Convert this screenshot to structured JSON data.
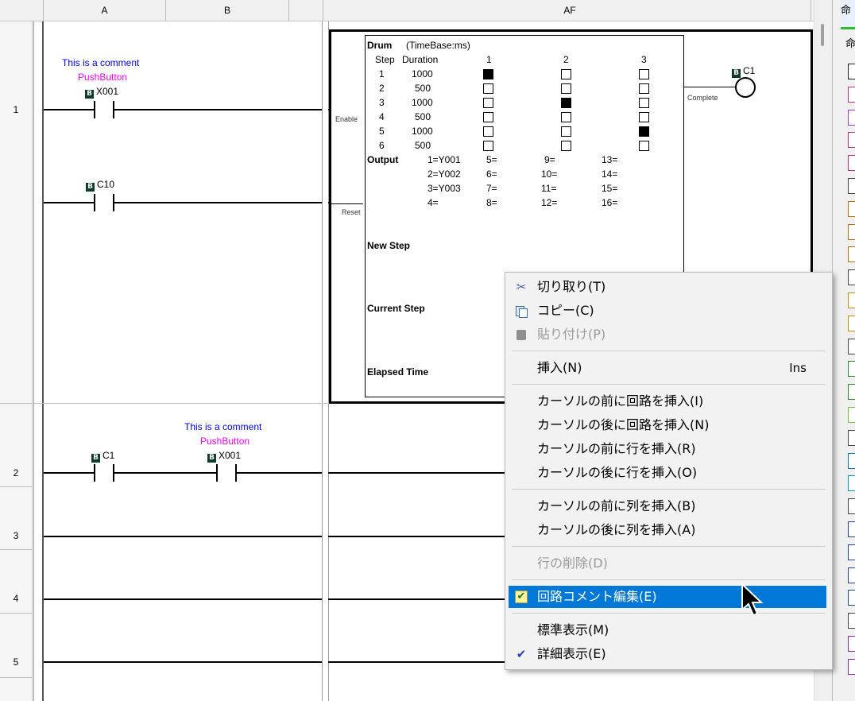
{
  "columns": {
    "a": "A",
    "b": "B",
    "af": "AF"
  },
  "rows": [
    "1",
    "2",
    "3",
    "4",
    "5"
  ],
  "rung1": {
    "comment": "This is a comment",
    "comment2": "PushButton",
    "contact1": "X001",
    "contact2": "C10",
    "coil": "C1",
    "enable": "Enable",
    "reset": "Reset",
    "complete": "Complete"
  },
  "rung2": {
    "contact1": "C1",
    "comment": "This is a comment",
    "comment2": "PushButton",
    "contact2": "X001"
  },
  "drum": {
    "title": "Drum",
    "timebase": "(TimeBase:ms)",
    "step_hdr": "Step",
    "duration_hdr": "Duration",
    "col_hdrs": [
      "1",
      "2",
      "3"
    ],
    "steps": [
      {
        "step": "1",
        "duration": "1000",
        "states": [
          1,
          0,
          0
        ]
      },
      {
        "step": "2",
        "duration": "500",
        "states": [
          0,
          0,
          0
        ]
      },
      {
        "step": "3",
        "duration": "1000",
        "states": [
          0,
          1,
          0
        ]
      },
      {
        "step": "4",
        "duration": "500",
        "states": [
          0,
          0,
          0
        ]
      },
      {
        "step": "5",
        "duration": "1000",
        "states": [
          0,
          0,
          1
        ]
      },
      {
        "step": "6",
        "duration": "500",
        "states": [
          0,
          0,
          0
        ]
      }
    ],
    "output_label": "Output",
    "outputs": [
      [
        "1=Y001",
        "5=",
        "9=",
        "13="
      ],
      [
        "2=Y002",
        "6=",
        "10=",
        "14="
      ],
      [
        "3=Y003",
        "7=",
        "11=",
        "15="
      ],
      [
        "4=",
        "8=",
        "12=",
        "16="
      ]
    ],
    "new_step": "New Step",
    "current_step": "Current Step",
    "elapsed_time": "Elapsed Time"
  },
  "context_menu": {
    "cut": "切り取り(T)",
    "copy": "コピー(C)",
    "paste": "貼り付け(P)",
    "insert": "挿入(N)",
    "insert_shortcut": "Ins",
    "ins_rung_before": "カーソルの前に回路を挿入(I)",
    "ins_rung_after": "カーソルの後に回路を挿入(N)",
    "ins_row_before": "カーソルの前に行を挿入(R)",
    "ins_row_after": "カーソルの後に行を挿入(O)",
    "ins_col_before": "カーソルの前に列を挿入(B)",
    "ins_col_after": "カーソルの後に列を挿入(A)",
    "delete_row": "行の削除(D)",
    "edit_rung_comment": "回路コメント編集(E)",
    "standard_view": "標準表示(M)",
    "detail_view": "詳細表示(E)"
  },
  "right_panel": {
    "tab": "命",
    "title": "命"
  },
  "icons": {
    "cut": "scissors-icon",
    "copy": "copy-icon",
    "paste": "paste-icon",
    "edit": "edit-check-icon",
    "check": "checkmark-icon"
  },
  "colors": {
    "selected": "#0078d7",
    "comment": "#0000ff",
    "pushbutton": "#ff00ff"
  }
}
